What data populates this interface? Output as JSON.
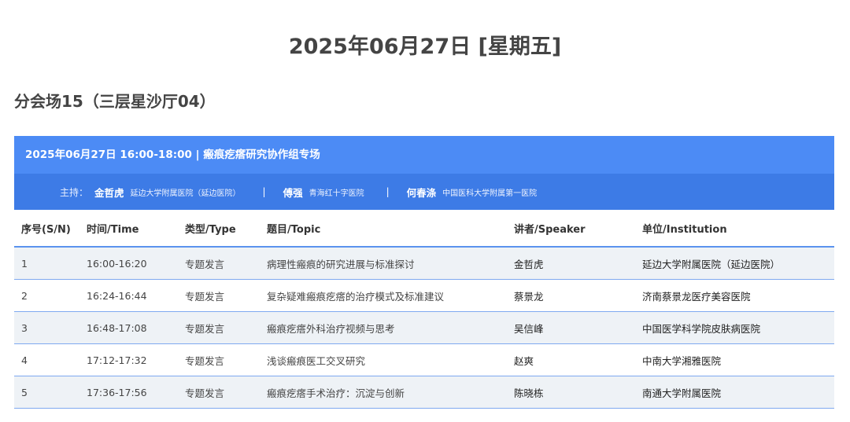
{
  "page": {
    "date_title": "2025年06月27日 [星期五]",
    "room_title": "分会场15（三层星沙厅04）"
  },
  "session": {
    "header": "2025年06月27日 16:00-18:00 | 瘢痕疙瘩研究协作组专场",
    "host_label": "主持：",
    "hosts": [
      {
        "name": "金哲虎",
        "org": "延边大学附属医院（延边医院）"
      },
      {
        "name": "傅强",
        "org": "青海红十字医院"
      },
      {
        "name": "何春涤",
        "org": "中国医科大学附属第一医院"
      }
    ],
    "separator": "|"
  },
  "table": {
    "columns": [
      "序号(S/N)",
      "时间/Time",
      "类型/Type",
      "题目/Topic",
      "讲者/Speaker",
      "单位/Institution"
    ],
    "rows": [
      {
        "sn": "1",
        "time": "16:00-16:20",
        "type": "专题发言",
        "topic": "病理性瘢痕的研究进展与标准探讨",
        "speaker": "金哲虎",
        "institution": "延边大学附属医院（延边医院）"
      },
      {
        "sn": "2",
        "time": "16:24-16:44",
        "type": "专题发言",
        "topic": "复杂疑难瘢痕疙瘩的治疗模式及标准建议",
        "speaker": "蔡景龙",
        "institution": "济南蔡景龙医疗美容医院"
      },
      {
        "sn": "3",
        "time": "16:48-17:08",
        "type": "专题发言",
        "topic": "瘢痕疙瘩外科治疗视频与思考",
        "speaker": "吴信峰",
        "institution": "中国医学科学院皮肤病医院"
      },
      {
        "sn": "4",
        "time": "17:12-17:32",
        "type": "专题发言",
        "topic": "浅谈瘢痕医工交叉研究",
        "speaker": "赵爽",
        "institution": "中南大学湘雅医院"
      },
      {
        "sn": "5",
        "time": "17:36-17:56",
        "type": "专题发言",
        "topic": "瘢痕疙瘩手术治疗：沉淀与创新",
        "speaker": "陈晓栋",
        "institution": "南通大学附属医院"
      }
    ]
  },
  "colors": {
    "header_blue": "#4c8bf5",
    "host_bar_blue": "#3d7be6",
    "row_shade": "#eef2f6",
    "row_border": "#7fa9f0"
  }
}
